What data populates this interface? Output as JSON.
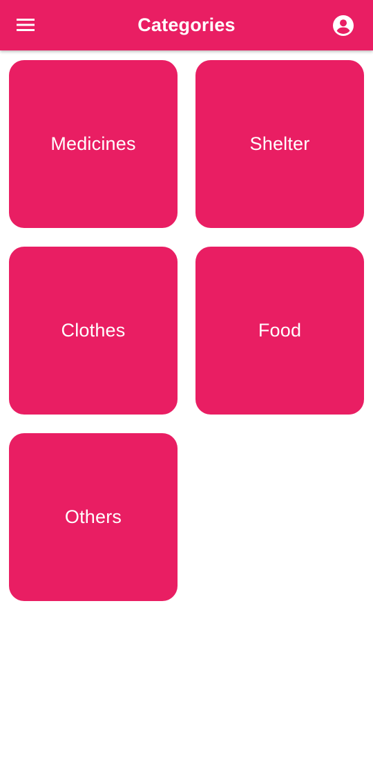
{
  "colors": {
    "accent": "#E91E63",
    "on_accent": "#FFFFFF",
    "background": "#FFFFFF"
  },
  "app_bar": {
    "menu_icon": "hamburger-menu-icon",
    "title": "Categories",
    "account_icon": "account-circle-icon"
  },
  "categories": [
    {
      "label": "Medicines"
    },
    {
      "label": "Shelter"
    },
    {
      "label": "Clothes"
    },
    {
      "label": "Food"
    },
    {
      "label": "Others"
    }
  ]
}
